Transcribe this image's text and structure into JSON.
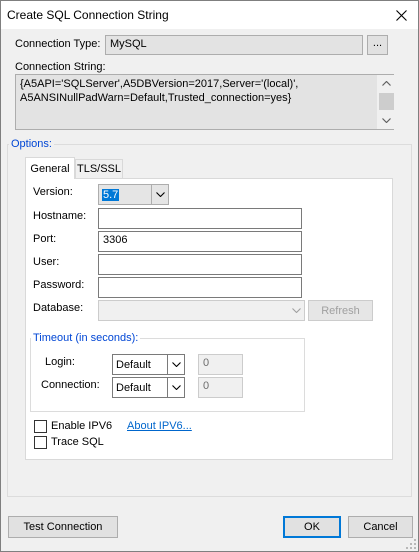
{
  "dialog": {
    "title": "Create SQL Connection String",
    "close_icon": "close-icon"
  },
  "connection_type": {
    "label": "Connection Type:",
    "value": "MySQL",
    "browse_label": "..."
  },
  "connection_string": {
    "label": "Connection String:",
    "line1": "{A5API='SQLServer',A5DBVersion=2017,Server='(local)',",
    "line2": "A5ANSINullPadWarn=Default,Trusted_connection=yes}"
  },
  "options": {
    "title": "Options:",
    "tabs": [
      {
        "label": "General",
        "active": true
      },
      {
        "label": "TLS/SSL",
        "active": false
      }
    ],
    "version": {
      "label": "Version:",
      "value": "5.7"
    },
    "hostname": {
      "label": "Hostname:",
      "value": ""
    },
    "port": {
      "label": "Port:",
      "value": "3306"
    },
    "user": {
      "label": "User:",
      "value": ""
    },
    "password": {
      "label": "Password:",
      "value": ""
    },
    "database": {
      "label": "Database:",
      "value": "",
      "refresh_label": "Refresh"
    },
    "timeout": {
      "title": "Timeout (in seconds):",
      "login": {
        "label": "Login:",
        "mode": "Default",
        "value": "0"
      },
      "connection": {
        "label": "Connection:",
        "mode": "Default",
        "value": "0"
      }
    },
    "enable_ipv6": {
      "label": "Enable IPV6",
      "checked": false
    },
    "about_ipv6": "About IPV6...",
    "trace_sql": {
      "label": "Trace SQL",
      "checked": false
    }
  },
  "footer": {
    "test_connection": "Test Connection",
    "ok": "OK",
    "cancel": "Cancel"
  },
  "colors": {
    "accent": "#0078d7",
    "group_title": "#0046d5",
    "link": "#0066cc"
  }
}
